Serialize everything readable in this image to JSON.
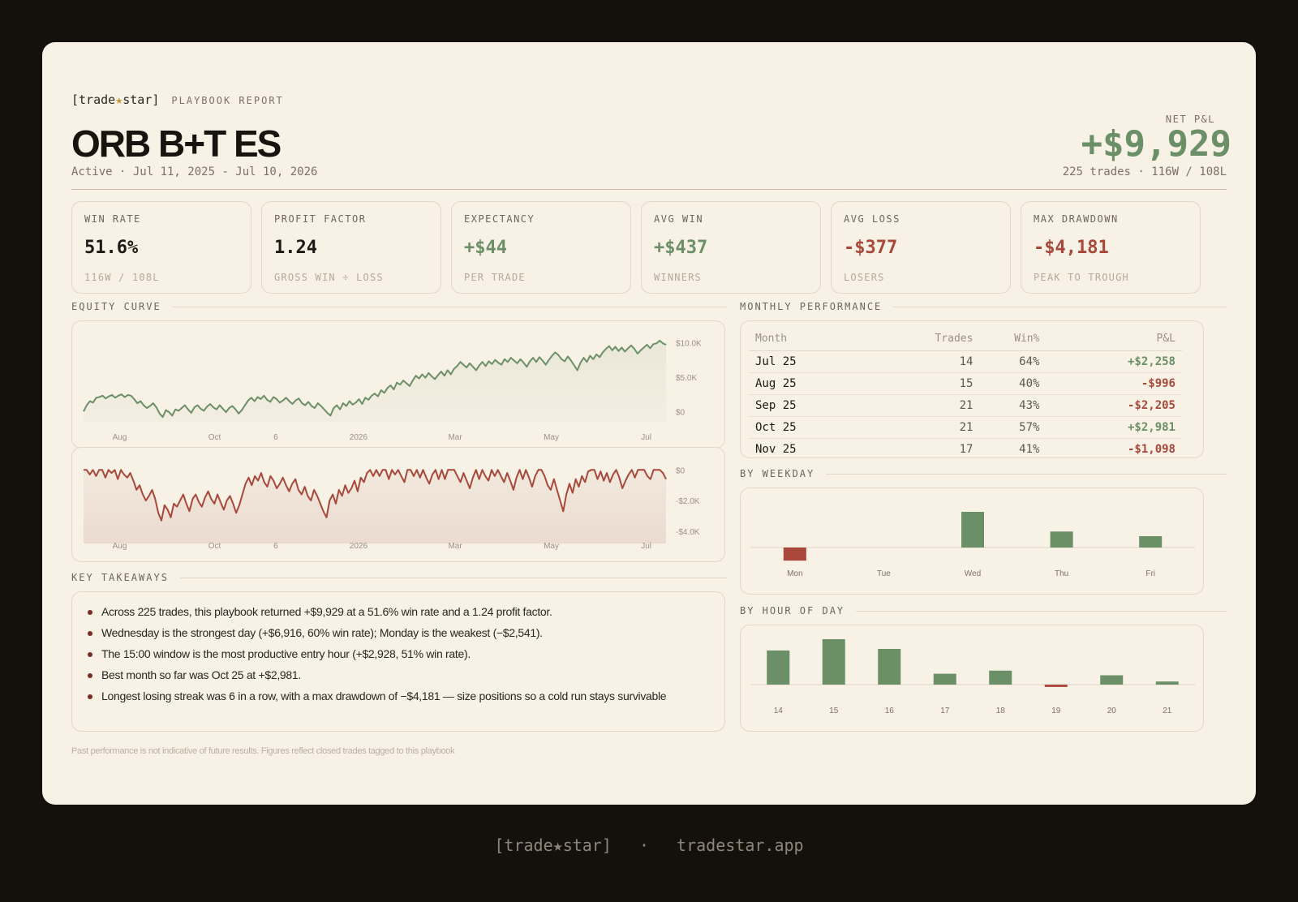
{
  "brand": {
    "open": "[trade",
    "star": "★",
    "close": "star]",
    "subtitle": "PLAYBOOK REPORT"
  },
  "header": {
    "title": "ORB B+T ES",
    "daterange": "Active · Jul 11, 2025 - Jul 10, 2026",
    "net_label": "NET P&L",
    "net_value": "+$9,929",
    "net_sub": "225 trades · 116W / 108L"
  },
  "stats": [
    {
      "label": "WIN RATE",
      "value": "51.6%",
      "sub": "116W / 108L",
      "tone": "neutral"
    },
    {
      "label": "PROFIT FACTOR",
      "value": "1.24",
      "sub": "GROSS WIN ÷ LOSS",
      "tone": "neutral"
    },
    {
      "label": "EXPECTANCY",
      "value": "+$44",
      "sub": "PER TRADE",
      "tone": "pos"
    },
    {
      "label": "AVG WIN",
      "value": "+$437",
      "sub": "WINNERS",
      "tone": "pos"
    },
    {
      "label": "AVG LOSS",
      "value": "-$377",
      "sub": "LOSERS",
      "tone": "neg"
    },
    {
      "label": "MAX DRAWDOWN",
      "value": "-$4,181",
      "sub": "PEAK TO TROUGH",
      "tone": "neg"
    }
  ],
  "sections": {
    "equity": "EQUITY CURVE",
    "monthly": "MONTHLY PERFORMANCE",
    "weekday": "BY WEEKDAY",
    "hour": "BY HOUR OF DAY",
    "takeaways": "KEY TAKEAWAYS"
  },
  "colors": {
    "positive": "#6b8f66",
    "negative": "#a9473a",
    "background": "#f7f1e6"
  },
  "monthly": {
    "headers": [
      "Month",
      "Trades",
      "Win%",
      "P&L"
    ],
    "rows": [
      {
        "month": "Jul 25",
        "trades": "14",
        "win": "64%",
        "pnl": "+$2,258",
        "tone": "pos"
      },
      {
        "month": "Aug 25",
        "trades": "15",
        "win": "40%",
        "pnl": "-$996",
        "tone": "neg"
      },
      {
        "month": "Sep 25",
        "trades": "21",
        "win": "43%",
        "pnl": "-$2,205",
        "tone": "neg"
      },
      {
        "month": "Oct 25",
        "trades": "21",
        "win": "57%",
        "pnl": "+$2,981",
        "tone": "pos"
      },
      {
        "month": "Nov 25",
        "trades": "17",
        "win": "41%",
        "pnl": "-$1,098",
        "tone": "neg"
      }
    ]
  },
  "takeaways": [
    "Across 225 trades, this playbook returned +$9,929 at a 51.6% win rate and a 1.24 profit factor.",
    "Wednesday is the strongest day (+$6,916, 60% win rate); Monday is the weakest (−$2,541).",
    "The 15:00 window is the most productive entry hour (+$2,928, 51% win rate).",
    "Best month so far was Oct 25 at +$2,981.",
    "Longest losing streak was 6 in a row, with a max drawdown of −$4,181 — size positions so a cold run stays survivable"
  ],
  "disclaimer": "Past performance is not indicative of future results. Figures reflect closed trades tagged to this playbook",
  "footer": {
    "brand_open": "[trade",
    "brand_star": "★",
    "brand_close": "star]",
    "sep": "·",
    "url": "tradestar.app"
  },
  "chart_data": [
    {
      "type": "area",
      "name": "equity",
      "xticks": [
        "Aug",
        "Oct",
        "6",
        "2026",
        "Mar",
        "May",
        "Jul"
      ],
      "yticks": [
        "$10.0K",
        "$5.0K",
        "$0"
      ],
      "ylim": [
        -1500,
        11000
      ],
      "values": [
        0,
        900,
        1500,
        1300,
        2000,
        2100,
        2300,
        1900,
        2200,
        2400,
        2000,
        2300,
        2500,
        2100,
        2400,
        2300,
        1800,
        1200,
        1500,
        900,
        500,
        800,
        1200,
        600,
        -300,
        -800,
        200,
        -100,
        -600,
        300,
        100,
        500,
        900,
        300,
        -200,
        600,
        900,
        400,
        100,
        700,
        1100,
        600,
        300,
        900,
        400,
        -100,
        500,
        800,
        300,
        -300,
        200,
        900,
        1600,
        2000,
        1500,
        2100,
        1800,
        2300,
        1700,
        1400,
        2100,
        1800,
        1300,
        1600,
        2000,
        1500,
        1100,
        1600,
        1900,
        1200,
        900,
        1400,
        800,
        500,
        1200,
        800,
        300,
        -200,
        -600,
        500,
        900,
        300,
        1200,
        800,
        1500,
        1000,
        1300,
        1800,
        1100,
        2000,
        1700,
        2300,
        2600,
        2200,
        3100,
        2700,
        3400,
        3800,
        3200,
        4200,
        3900,
        4500,
        4100,
        3700,
        4500,
        5200,
        4800,
        5400,
        4900,
        5600,
        5100,
        4700,
        5300,
        5800,
        5200,
        6000,
        5400,
        6200,
        6600,
        7200,
        6800,
        6400,
        7000,
        6500,
        6000,
        6700,
        7200,
        6600,
        7300,
        6900,
        7500,
        7100,
        6800,
        7600,
        7200,
        7800,
        7400,
        7000,
        7600,
        7100,
        6500,
        7300,
        7800,
        7200,
        7900,
        7400,
        6800,
        7500,
        8100,
        8600,
        8200,
        7600,
        7300,
        8000,
        7400,
        6700,
        6000,
        7100,
        7800,
        7200,
        8100,
        7600,
        8300,
        7900,
        8600,
        9100,
        9500,
        8900,
        9400,
        8800,
        9300,
        8700,
        9200,
        9600,
        9100,
        8400,
        8900,
        9300,
        9700,
        9200,
        9800,
        9900,
        10300,
        9900,
        9700
      ],
      "color": "#6b8f66"
    },
    {
      "type": "area",
      "name": "drawdown",
      "xticks": [
        "Aug",
        "Oct",
        "6",
        "2026",
        "Mar",
        "May",
        "Jul"
      ],
      "yticks": [
        "$0",
        "-$2.0K",
        "-$4.0K"
      ],
      "ylim": [
        -4800,
        600
      ],
      "values": [
        0,
        0,
        -300,
        0,
        -400,
        0,
        0,
        -500,
        0,
        -200,
        0,
        -600,
        0,
        -300,
        -500,
        -200,
        -700,
        -1300,
        -1000,
        -1600,
        -2000,
        -1700,
        -1300,
        -1900,
        -2800,
        -3300,
        -2300,
        -2600,
        -3100,
        -2200,
        -2400,
        -2000,
        -1600,
        -2200,
        -2700,
        -1900,
        -1600,
        -2100,
        -2400,
        -1800,
        -1400,
        -1900,
        -2200,
        -1600,
        -2100,
        -2600,
        -2000,
        -1700,
        -2200,
        -2800,
        -2300,
        -1600,
        -900,
        -500,
        -1000,
        -400,
        -700,
        -200,
        -800,
        -1100,
        -400,
        -700,
        -1200,
        -900,
        -500,
        -1000,
        -1400,
        -900,
        -600,
        -1300,
        -1600,
        -1100,
        -1700,
        -2000,
        -1300,
        -1700,
        -2200,
        -2700,
        -3100,
        -2000,
        -1600,
        -2200,
        -1300,
        -1700,
        -1000,
        -1500,
        -1200,
        -700,
        -1400,
        -500,
        -800,
        -200,
        0,
        -400,
        0,
        -400,
        0,
        0,
        -600,
        0,
        -300,
        0,
        -400,
        -800,
        0,
        0,
        -400,
        0,
        -500,
        0,
        -500,
        -900,
        -300,
        0,
        -600,
        0,
        -600,
        0,
        0,
        0,
        -400,
        -800,
        -200,
        -700,
        -1200,
        -500,
        0,
        -600,
        0,
        -400,
        -700,
        0,
        -400,
        0,
        -400,
        -800,
        -200,
        -700,
        -1300,
        -500,
        0,
        -600,
        0,
        -500,
        -1100,
        -400,
        0,
        0,
        -400,
        -1000,
        -1300,
        -600,
        -1300,
        -2000,
        -2700,
        -1600,
        -900,
        -1500,
        -600,
        -1100,
        -400,
        -800,
        -100,
        0,
        0,
        -600,
        -100,
        -700,
        -200,
        -800,
        -300,
        0,
        -500,
        -1200,
        -700,
        -300,
        0,
        -500,
        0,
        0,
        0,
        -400,
        -600,
        0,
        0,
        0,
        -200,
        -600
      ],
      "color": "#a9473a"
    },
    {
      "type": "bar",
      "name": "by-weekday",
      "categories": [
        "Mon",
        "Tue",
        "Wed",
        "Thu",
        "Fri"
      ],
      "values": [
        -2541,
        0,
        6916,
        3100,
        2200
      ]
    },
    {
      "type": "bar",
      "name": "by-hour",
      "categories": [
        "14",
        "15",
        "16",
        "17",
        "18",
        "19",
        "20",
        "21"
      ],
      "values": [
        2200,
        2928,
        2300,
        700,
        900,
        -150,
        600,
        200
      ]
    }
  ]
}
